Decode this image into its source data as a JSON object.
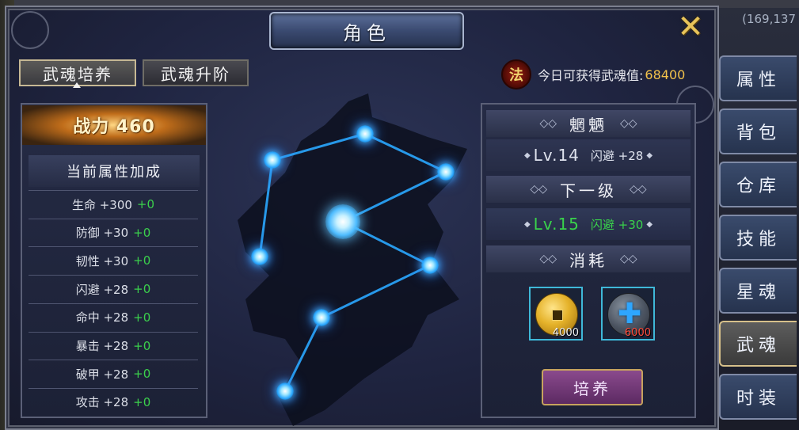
{
  "window": {
    "title": "角色"
  },
  "background": {
    "coords": "(169,137"
  },
  "tabs": [
    {
      "label": "武魂培养",
      "active": true
    },
    {
      "label": "武魂升阶",
      "active": false
    }
  ],
  "soul": {
    "badge": "法",
    "label": "今日可获得武魂值:",
    "value": "68400"
  },
  "power": {
    "label": "战力 460"
  },
  "stats": {
    "title": "当前属性加成",
    "rows": [
      {
        "label": "生命 +300",
        "bonus": "+0"
      },
      {
        "label": "防御 +30",
        "bonus": "+0"
      },
      {
        "label": "韧性 +30",
        "bonus": "+0"
      },
      {
        "label": "闪避 +28",
        "bonus": "+0"
      },
      {
        "label": "命中 +28",
        "bonus": "+0"
      },
      {
        "label": "暴击 +28",
        "bonus": "+0"
      },
      {
        "label": "破甲 +28",
        "bonus": "+0"
      },
      {
        "label": "攻击 +28",
        "bonus": "+0"
      }
    ]
  },
  "soul_info": {
    "name": "魍魉",
    "current": {
      "level": "Lv.14",
      "attr": "闪避 +28"
    },
    "next_title": "下一级",
    "next": {
      "level": "Lv.15",
      "attr": "闪避 +30"
    },
    "cost_title": "消耗",
    "items": [
      {
        "icon": "gold-coin-icon",
        "count": "4000"
      },
      {
        "icon": "upgrade-stone-icon",
        "count": "6000"
      }
    ],
    "train_label": "培养"
  },
  "side_tabs": [
    {
      "label": "属性",
      "active": false
    },
    {
      "label": "背包",
      "active": false
    },
    {
      "label": "仓库",
      "active": false
    },
    {
      "label": "技能",
      "active": false
    },
    {
      "label": "星魂",
      "active": false
    },
    {
      "label": "武魂",
      "active": true
    },
    {
      "label": "时装",
      "active": false
    }
  ],
  "colors": {
    "accent_gold": "#f3c24b",
    "bonus_green": "#3bd04c",
    "node_blue": "#2aa7ff"
  }
}
